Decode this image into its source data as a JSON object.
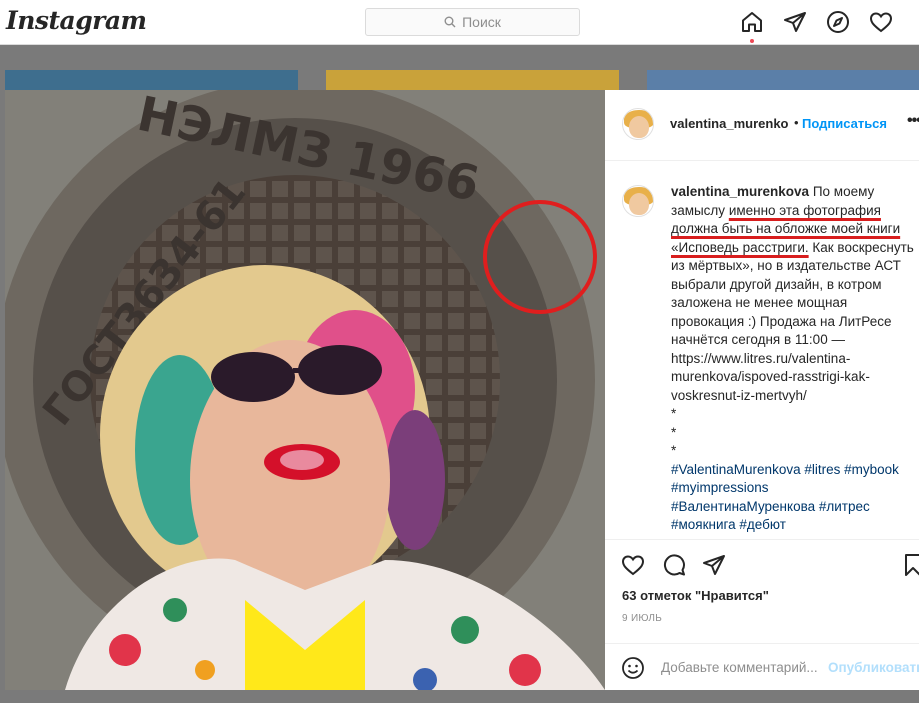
{
  "header": {
    "logo": "Instagram",
    "search_placeholder": "Поиск"
  },
  "nav_icons": [
    "home-icon",
    "direct-icon",
    "explore-icon",
    "heart-icon"
  ],
  "post": {
    "username": "valentina_murenko",
    "dot": "•",
    "follow_label": "Подписаться",
    "more_label": "•••",
    "caption": {
      "username": "valentina_murenkova",
      "pre": "По моему замыслу ",
      "highlighted": "именно эта фотография должна быть на обложке моей книги «Исповедь расстриги.",
      "post": " Как воскреснуть из мёртвых», но в издательстве АСТ выбрали другой дизайн, в котром заложена не менее мощная провокация :) Продажа на ЛитРесе начнётся сегодня в 11:00 — https://www.litres.ru/valentina-murenkova/ispoved-rasstrigi-kak-voskresnut-iz-mertvyh/",
      "stars": [
        "*",
        "*",
        "*"
      ],
      "hashtags_line1": "#ValentinaMurenkova #litres #mybook",
      "hashtags_line2": "#myimpressions",
      "hashtags_line3": "#ВалентинаМуренкова #литрес",
      "hashtags_line4": "#моякнига #дебют"
    },
    "likes": "63 отметок \"Нравится\"",
    "date": "9 ИЮЛЬ",
    "comment_placeholder": "Добавьте комментарий...",
    "publish_label": "Опубликовать"
  },
  "photo": {
    "cover_text_top": "НЭЛМЗ 1966",
    "cover_text_left": "ГОСТ3634-61"
  },
  "colors": {
    "accent": "#0095f6",
    "highlight": "#d81e1e",
    "hashtag": "#00376b"
  }
}
